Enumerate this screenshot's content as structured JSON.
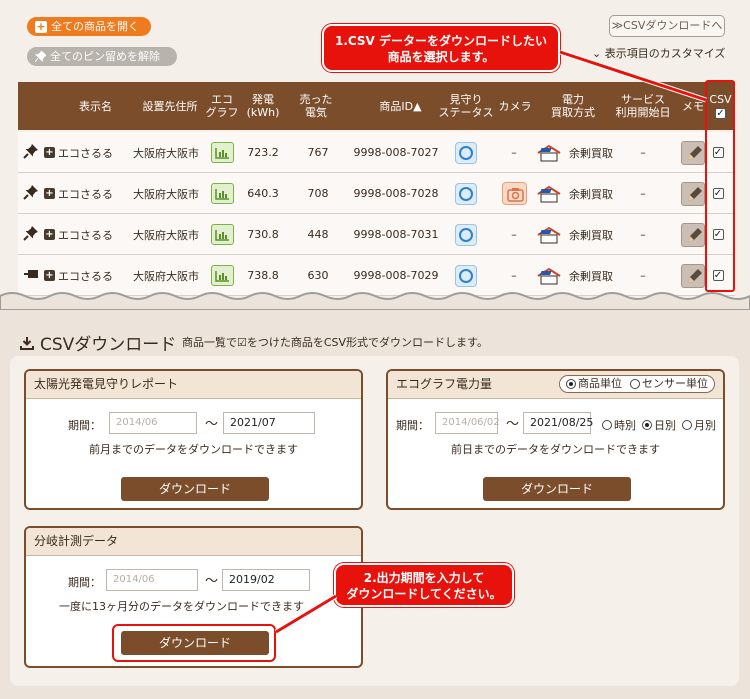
{
  "top": {
    "open_all_label": "全ての商品を開く",
    "unpin_all_label": "全てのピン留めを解除",
    "csv_download_button": "≫CSVダウンロードへ",
    "customize_label": "表示項目のカスタマイズ"
  },
  "callout1": {
    "line1": "1.CSV データーをダウンロードしたい",
    "line2": "商品を選択します。"
  },
  "callout2": {
    "line1": "2.出力期間を入力して",
    "line2": "ダウンロードしてください。"
  },
  "table": {
    "headers": {
      "name": "表示名",
      "location": "設置先住所",
      "eco_l1": "エコ",
      "eco_l2": "グラフ",
      "gen_l1": "発電",
      "gen_l2": "(kWh)",
      "sold_l1": "売った",
      "sold_l2": "電気",
      "product_id": "商品ID▲",
      "watch_l1": "見守り",
      "watch_l2": "ステータス",
      "camera": "カメラ",
      "power_l1": "電力",
      "power_l2": "買取方式",
      "service_l1": "サービス",
      "service_l2": "利用開始日",
      "memo": "メモ",
      "csv": "CSV"
    },
    "rows": [
      {
        "name": "エコさるる",
        "location": "大阪府大阪市",
        "gen": "723.2",
        "sold": "767",
        "id": "9998-008-7027",
        "camera": "–",
        "power": "余剰買取",
        "service": "–"
      },
      {
        "name": "エコさるる",
        "location": "大阪府大阪市",
        "gen": "640.3",
        "sold": "708",
        "id": "9998-008-7028",
        "camera": "",
        "power": "余剰買取",
        "service": "–"
      },
      {
        "name": "エコさるる",
        "location": "大阪府大阪市",
        "gen": "730.8",
        "sold": "448",
        "id": "9998-008-7031",
        "camera": "–",
        "power": "余剰買取",
        "service": "–"
      },
      {
        "name": "エコさるる",
        "location": "大阪府大阪市",
        "gen": "738.8",
        "sold": "630",
        "id": "9998-008-7029",
        "camera": "–",
        "power": "余剰買取",
        "service": "–"
      }
    ]
  },
  "csv_section": {
    "title": "CSVダウンロード",
    "description": "商品一覧で☑をつけた商品をCSV形式でダウンロードします。"
  },
  "panel_solar": {
    "title": "太陽光発電見守りレポート",
    "period_label": "期間：",
    "from_placeholder": "2014/06",
    "to_value": "2021/07",
    "tilde": "～",
    "note": "前月までのデータをダウンロードできます",
    "download": "ダウンロード"
  },
  "panel_eco": {
    "title": "エコグラフ電力量",
    "unit_product": "商品単位",
    "unit_sensor": "センサー単位",
    "period_label": "期間：",
    "from_placeholder": "2014/06/02",
    "to_value": "2021/08/25",
    "tilde": "～",
    "hourly": "時別",
    "daily": "日別",
    "monthly": "月別",
    "note": "前日までのデータをダウンロードできます",
    "download": "ダウンロード"
  },
  "panel_branch": {
    "title": "分岐計測データ",
    "period_label": "期間：",
    "from_placeholder": "2014/06",
    "to_value": "2019/02",
    "tilde": "～",
    "note": "一度に13ヶ月分のデータをダウンロードできます",
    "download": "ダウンロード"
  },
  "colors": {
    "brown": "#7b4d2b",
    "orange": "#f07a1e",
    "callout_red": "#e8120c"
  }
}
